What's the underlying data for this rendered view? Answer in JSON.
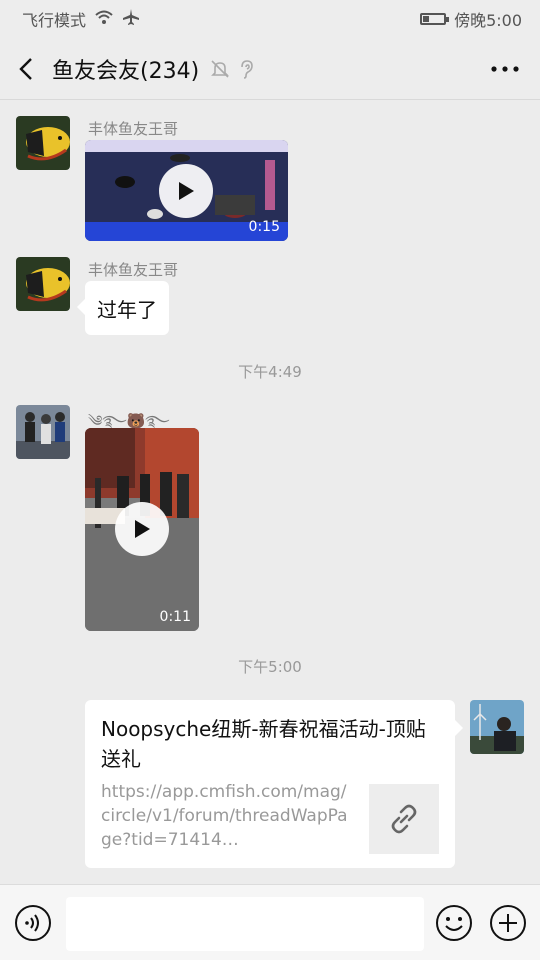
{
  "status_bar": {
    "left_text": "飞行模式",
    "right_text": "傍晚5:00",
    "battery_level": 0.25
  },
  "header": {
    "title": "鱼友会友(234)",
    "icons": [
      "back-icon",
      "mute-bell-icon",
      "ear-icon",
      "more-icon"
    ]
  },
  "messages": [
    {
      "type": "video",
      "sender": "丰体鱼友王哥",
      "duration": "0:15"
    },
    {
      "type": "text",
      "sender": "丰体鱼友王哥",
      "text": "过年了"
    },
    {
      "type": "timestamp",
      "text": "下午4:49"
    },
    {
      "type": "video",
      "sender": "༄࿐🐻࿐",
      "duration": "0:11"
    },
    {
      "type": "timestamp",
      "text": "下午5:00"
    },
    {
      "type": "link",
      "title": "Noopsyche纽斯-新春祝福活动-顶贴送礼",
      "url": "https://app.cmfish.com/mag/circle/v1/forum/threadWapPage?tid=71414…",
      "thumb_icon": "link-icon"
    }
  ],
  "input_bar": {
    "placeholder": "",
    "icons": [
      "voice-icon",
      "emoji-icon",
      "plus-icon"
    ]
  },
  "colors": {
    "background": "#ececec",
    "bubble": "#ffffff",
    "meta_text": "#999999"
  }
}
